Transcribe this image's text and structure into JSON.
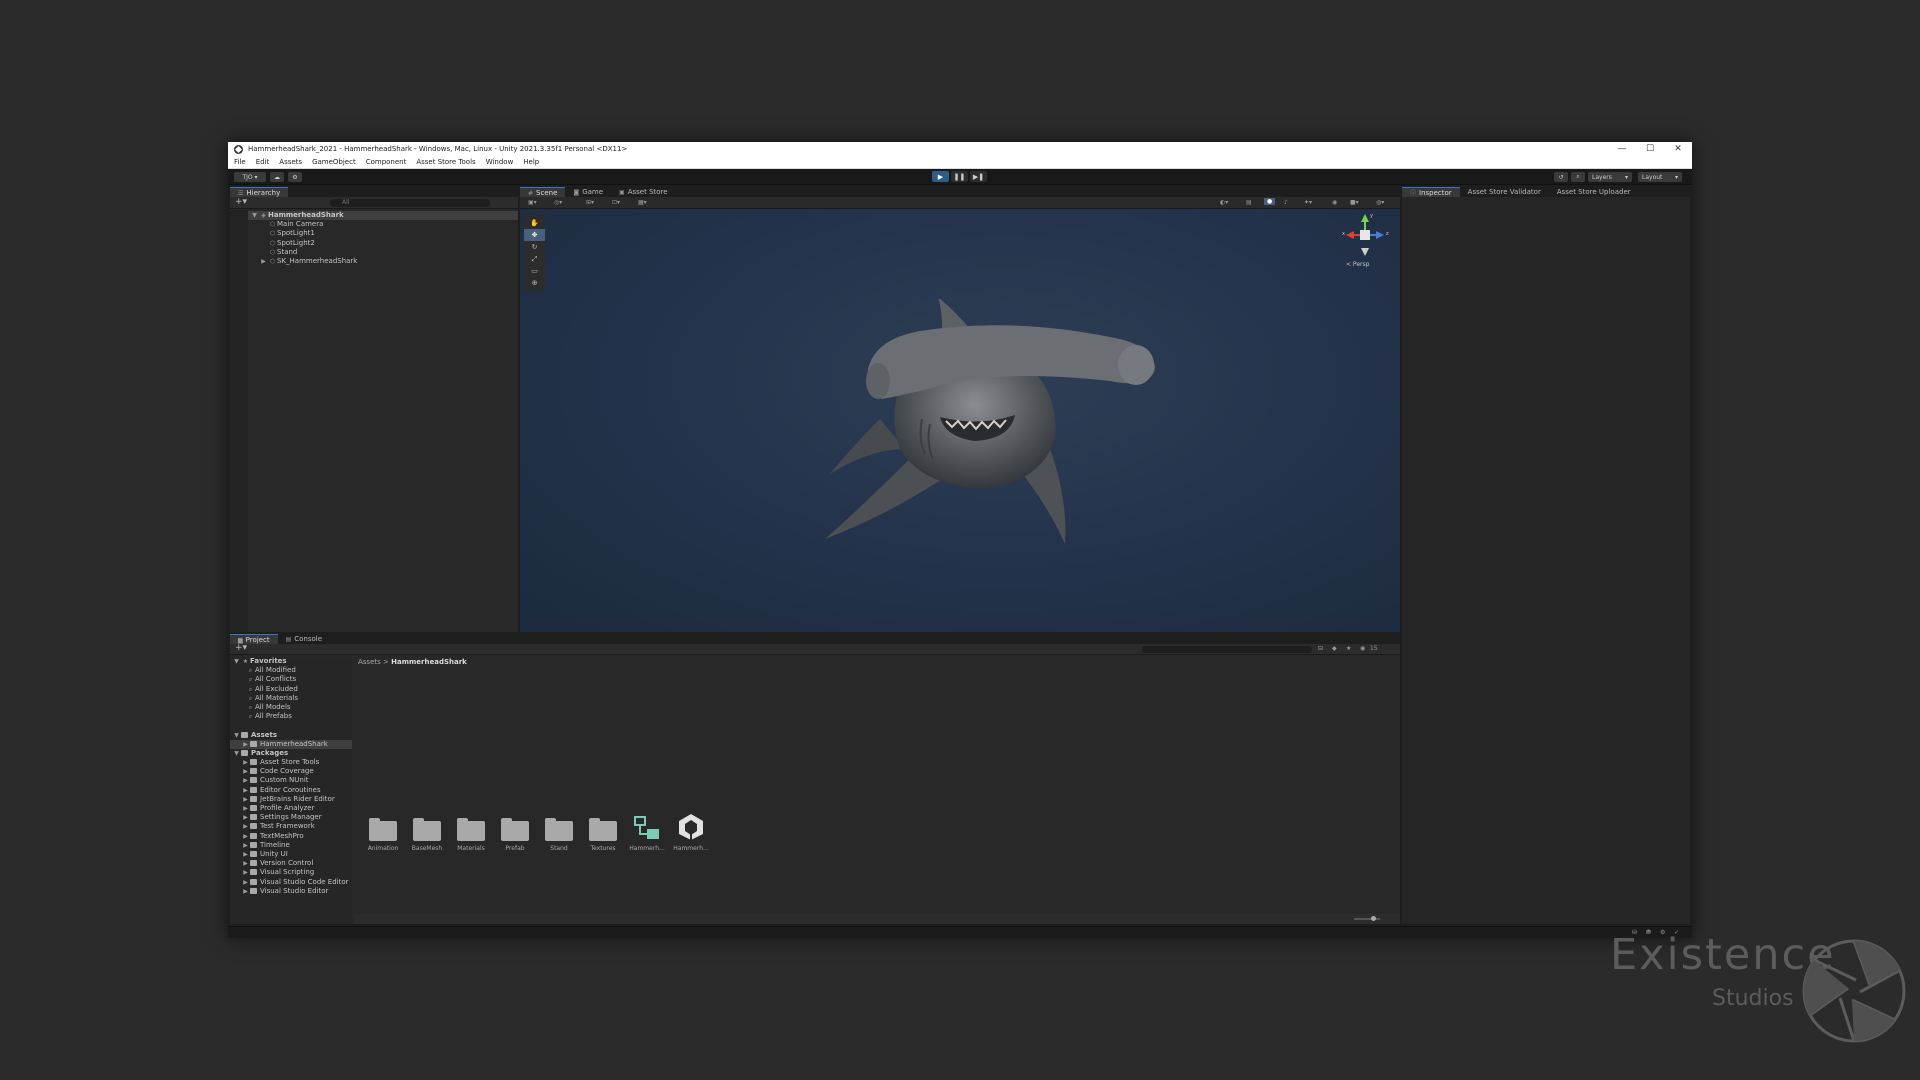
{
  "window": {
    "title": "HammerheadShark_2021 - HammerheadShark - Windows, Mac, Linux - Unity 2021.3.35f1 Personal <DX11>",
    "controls": [
      "—",
      "☐",
      "✕"
    ]
  },
  "menu": [
    "File",
    "Edit",
    "Assets",
    "GameObject",
    "Component",
    "Asset Store Tools",
    "Window",
    "Help"
  ],
  "toolbar": {
    "account_label": "TJO ▾",
    "layers_label": "Layers",
    "layout_label": "Layout",
    "play_icon": "▶",
    "pause_icon": "❚❚",
    "step_icon": "▶❚"
  },
  "hierarchy": {
    "tab": "Hierarchy",
    "search_placeholder": "All",
    "scene": "HammerheadShark",
    "items": [
      "Main Camera",
      "SpotLight1",
      "SpotLight2",
      "Stand",
      "SK_HammerheadShark"
    ]
  },
  "scene_view": {
    "tabs": [
      "Scene",
      "Game",
      "Asset Store"
    ],
    "projection": "< Persp",
    "gizmo_axes": {
      "y": "y",
      "x": "x",
      "z": "z"
    }
  },
  "inspector": {
    "tabs": [
      "Inspector",
      "Asset Store Validator",
      "Asset Store Uploader"
    ]
  },
  "project": {
    "tabs": [
      "Project",
      "Console"
    ],
    "favorites_label": "Favorites",
    "favorites": [
      "All Modified",
      "All Conflicts",
      "All Excluded",
      "All Materials",
      "All Models",
      "All Prefabs"
    ],
    "assets_label": "Assets",
    "assets_children": [
      "HammerheadShark"
    ],
    "packages_label": "Packages",
    "packages": [
      "Asset Store Tools",
      "Code Coverage",
      "Custom NUnit",
      "Editor Coroutines",
      "JetBrains Rider Editor",
      "Profile Analyzer",
      "Settings Manager",
      "Test Framework",
      "TextMeshPro",
      "Timeline",
      "Unity UI",
      "Version Control",
      "Visual Scripting",
      "Visual Studio Code Editor",
      "Visual Studio Editor"
    ],
    "breadcrumb": [
      "Assets",
      "HammerheadShark"
    ],
    "breadcrumb_sep": ">",
    "hidden_count": "15",
    "contents": [
      {
        "name": "Animation",
        "kind": "folder"
      },
      {
        "name": "BaseMesh",
        "kind": "folder"
      },
      {
        "name": "Materials",
        "kind": "folder"
      },
      {
        "name": "Prefab",
        "kind": "folder"
      },
      {
        "name": "Stand",
        "kind": "folder"
      },
      {
        "name": "Textures",
        "kind": "folder"
      },
      {
        "name": "Hammerh...",
        "kind": "prefab"
      },
      {
        "name": "Hammerh...",
        "kind": "scene"
      }
    ]
  },
  "watermark": {
    "word": "Existence",
    "sub": "Studios"
  },
  "colors": {
    "accent": "#3b73c7",
    "play_active": "#2c5d87",
    "scene_bg": "#23324a",
    "gizmo_y": "#7bd24a",
    "gizmo_x": "#d9403a",
    "gizmo_z": "#4a7bd9"
  }
}
